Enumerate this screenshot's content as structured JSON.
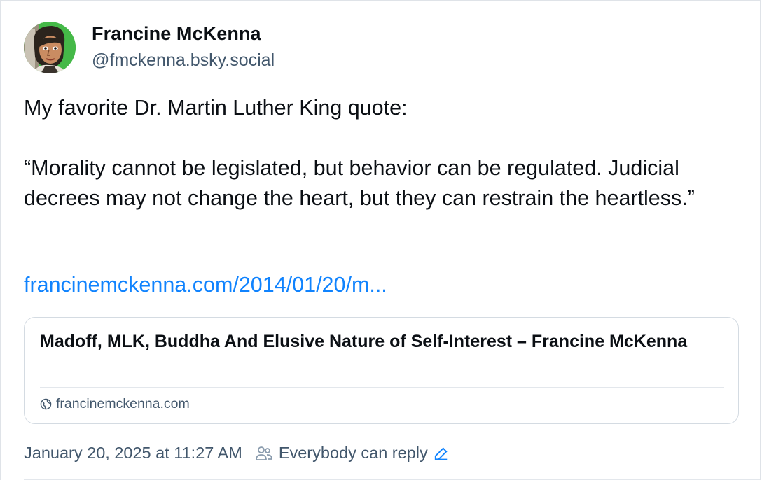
{
  "author": {
    "display_name": "Francine McKenna",
    "handle": "@fmckenna.bsky.social",
    "avatar_icon": "profile-avatar"
  },
  "post": {
    "intro": "My favorite Dr. Martin Luther King quote:",
    "quote": "“Morality cannot be legislated, but behavior can be regulated. Judicial decrees may not change the heart, but they can restrain the heartless.”",
    "link_text": "francinemckenna.com/2014/01/20/m..."
  },
  "embed": {
    "title": "Madoff, MLK, Buddha And Elusive Nature of Self-Interest – Francine McKenna",
    "domain": "francinemckenna.com",
    "domain_icon": "globe-icon"
  },
  "footer": {
    "timestamp": "January 20, 2025 at 11:27 AM",
    "reply_setting": "Everybody can reply",
    "reply_icon": "people-icon",
    "edit_icon": "pencil-icon"
  },
  "colors": {
    "link": "#1083fe",
    "muted": "#42576c",
    "text": "#0b0f14",
    "border": "#d4dbe2"
  }
}
